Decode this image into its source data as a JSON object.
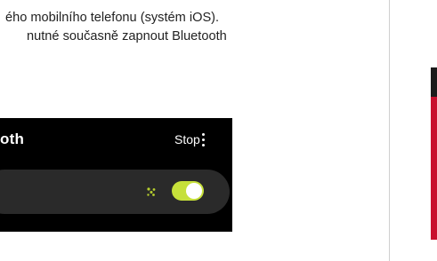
{
  "text": {
    "line_1": "ého mobilního telefonu (systém iOS).",
    "line_2": "nutné současně zapnout Bluetooth"
  },
  "phone": {
    "header_title": "oth",
    "stop_label": "Stop",
    "bluetooth_toggle_on": true
  },
  "colors": {
    "toggle_accent": "#c6e03a",
    "scan_icon": "#b7cf2e",
    "side_red": "#c8102e"
  },
  "icons": {
    "more": "more-vertical-icon",
    "scan": "scan-dots-icon"
  }
}
